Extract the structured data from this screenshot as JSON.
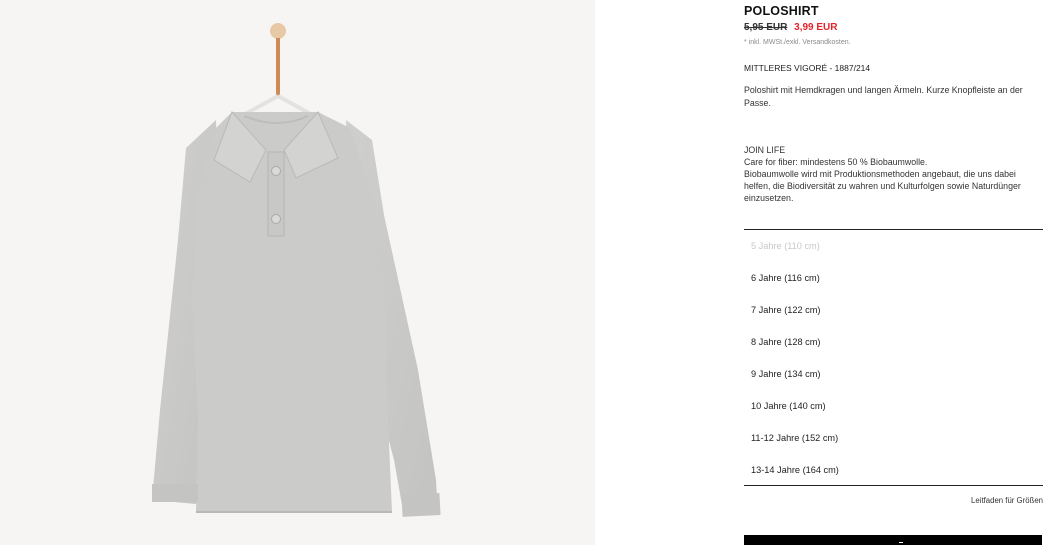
{
  "product": {
    "title": "POLOSHIRT",
    "old_price": "5,95 EUR",
    "new_price": "3,99 EUR",
    "tax_note": "* inkl. MWSt./exkl. Versandkosten.",
    "reference": "MITTLERES VIGORÉ - 1887/214",
    "description": "Poloshirt mit Hemdkragen und langen Ärmeln. Kurze Knopfleiste an der Passe.",
    "join_life": {
      "heading": "JOIN LIFE",
      "line1": "Care for fiber: mindestens 50 % Biobaumwolle.",
      "line2": "Biobaumwolle wird mit Produktionsmethoden angebaut, die uns dabei helfen, die Biodiversität zu wahren und Kulturfolgen sowie Naturdünger einzusetzen."
    },
    "image": "grey-long-sleeve-polo-shirt-on-hanger"
  },
  "sizes": [
    {
      "label": "5 Jahre (110 cm)",
      "available": false
    },
    {
      "label": "6 Jahre (116 cm)",
      "available": true
    },
    {
      "label": "7 Jahre (122 cm)",
      "available": true
    },
    {
      "label": "8 Jahre (128 cm)",
      "available": true
    },
    {
      "label": "9 Jahre (134 cm)",
      "available": true
    },
    {
      "label": "10 Jahre (140 cm)",
      "available": true
    },
    {
      "label": "11-12 Jahre (152 cm)",
      "available": true
    },
    {
      "label": "13-14 Jahre (164 cm)",
      "available": true
    }
  ],
  "size_guide_label": "Leitfaden für Größen",
  "colors": {
    "sale_red": "#e2242a",
    "shirt_grey": "#c9c9c7",
    "button_black": "#000000"
  }
}
